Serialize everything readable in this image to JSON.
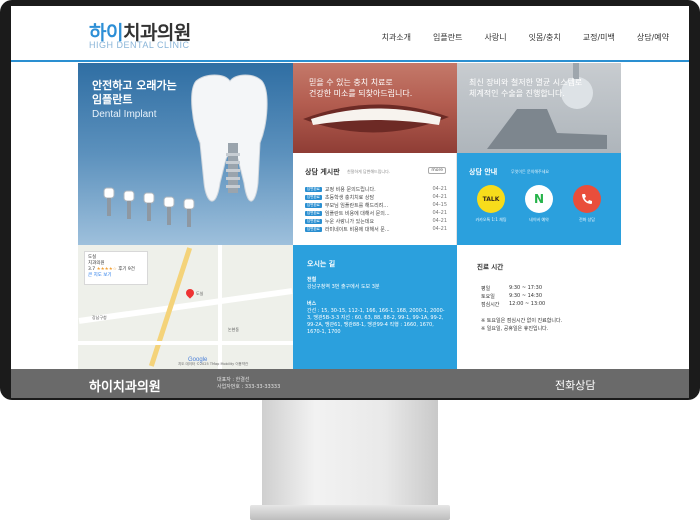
{
  "header": {
    "logo_blue": "하이",
    "logo_dark": "치과의원",
    "logo_sub": "HIGH DENTAL CLINIC",
    "nav": [
      "치과소개",
      "임플란트",
      "사랑니",
      "잇몸/충치",
      "교정/미백",
      "상담/예약"
    ]
  },
  "hero": {
    "line1": "안전하고 오래가는",
    "line2": "임플란트",
    "line3": "Dental Implant"
  },
  "smile": {
    "caption1": "믿을 수 있는 충치 치료로",
    "caption2": "건강한 미소를 되찾아드립니다."
  },
  "chair": {
    "caption1": "최신 장비와 철저한 멸균 시스템로",
    "caption2": "체계적인 수술을 진행합니다."
  },
  "board": {
    "title": "상담 게시판",
    "subtitle": "친절하게 답변해드립니다.",
    "more": "more",
    "tag": "답변완료",
    "rows": [
      {
        "title": "교정 비용 문의드립니다.",
        "date": "04-21"
      },
      {
        "title": "초등학생 충치치료 상담",
        "date": "04-21"
      },
      {
        "title": "부모님 임플란트를 해드리려...",
        "date": "04-15"
      },
      {
        "title": "임플란트 비용에 대해서 문의...",
        "date": "04-21"
      },
      {
        "title": "누운 사랑니가 있는데요",
        "date": "04-21"
      },
      {
        "title": "라미네이트 비용에 대해서 문...",
        "date": "04-21"
      }
    ]
  },
  "consult": {
    "title": "상담 안내",
    "subtitle": "무엇이든 문의해주세요",
    "kakao_icon": "TALK",
    "naver_icon": "N",
    "kakao_label": "카카오톡 1:1 채팅",
    "naver_label": "네이버 예약",
    "phone_label": "전화 상담"
  },
  "map": {
    "place": "도실",
    "place_type": "치과의원",
    "rating": "3.7",
    "rating_stars": "★★★★☆",
    "reviews": "후기 9건",
    "bigger": "큰 지도 보기",
    "label_a": "강남구청",
    "label_b": "도실",
    "label_c": "논현동",
    "google": "Google",
    "footer": "지도 데이터 ©2025 TMap Mobility  이용약관"
  },
  "directions": {
    "title": "오시는 길",
    "subway_title": "전철",
    "subway_text": "강남구청역 3번 출구에서 도보 3분",
    "bus_title": "버스",
    "bus_text": "간선 : 15, 30-15, 112-1, 166, 166-1, 168, 2000-1, 2000-3, 맹관5B-3-3 지선 : 60, 63, 88, 88-2, 99-1, 99-1A, 99-2, 99-2A, 맹관61, 맹관88-1, 맹관99-4 직행 : 1660, 1670, 1670-1, 1700"
  },
  "hours": {
    "title": "진료 시간",
    "rows": [
      {
        "day": "평일",
        "time": "9:30 ~ 17:30"
      },
      {
        "day": "토요일",
        "time": "9:30 ~ 14:30"
      },
      {
        "day": "점심시간",
        "time": "12:00 ~ 13:00"
      }
    ],
    "note1": "※ 토요일은 점심시간 없이 진료합니다.",
    "note2": "※ 일요일, 공휴일은 휴진입니다."
  },
  "footer": {
    "logo": "하이치과의원",
    "ceo": "대표자 : 한결선",
    "biz": "사업자번호 : 333-33-33333",
    "phone_title": "전화상담"
  },
  "colors": {
    "accent": "#2ba0dd",
    "footer": "#6a6a6a",
    "kakao": "#f7dc1b",
    "naver": "#26b34a",
    "phone": "#e94e3b"
  }
}
